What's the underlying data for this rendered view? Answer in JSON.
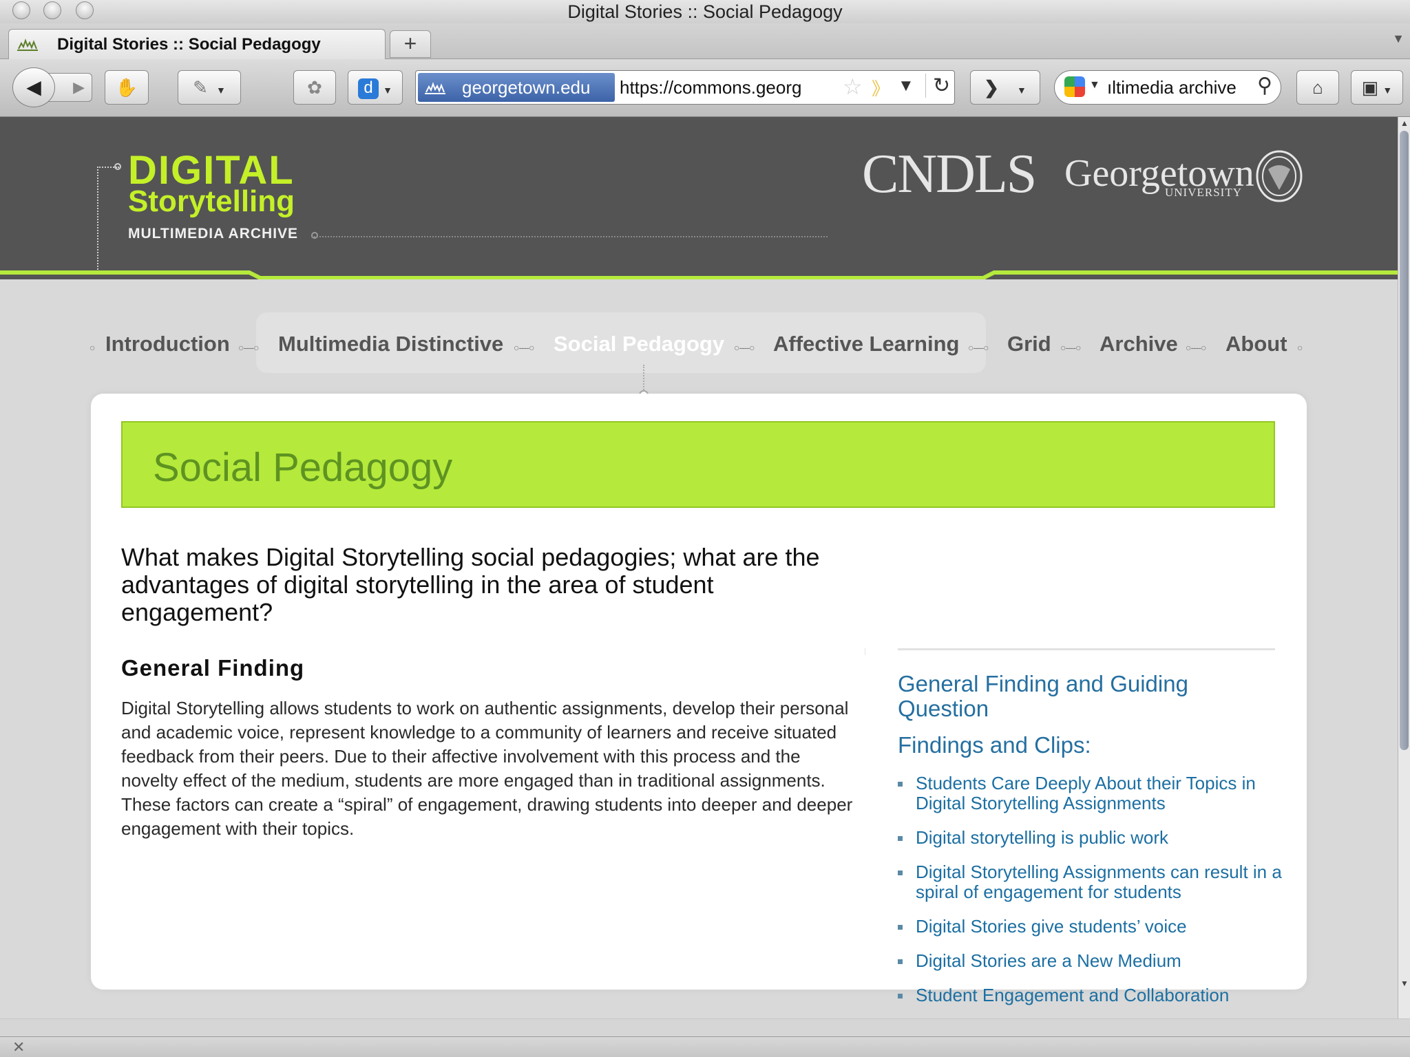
{
  "window": {
    "title": "Digital Stories :: Social Pedagogy"
  },
  "tabs": [
    {
      "label": "Digital Stories :: Social Pedagogy"
    }
  ],
  "toolbar": {
    "new_tab": "+",
    "back": "◀",
    "forward": "▶"
  },
  "url_bar": {
    "site_identity": "georgetown.edu",
    "url": "https://commons.georg"
  },
  "search_bar": {
    "value": "ıltimedia archive"
  },
  "site": {
    "logo": {
      "line1": "DIGITAL",
      "line2": "Storytelling",
      "line3": "MULTIMEDIA ARCHIVE"
    },
    "partner_logo": "CNDLS",
    "university": {
      "name": "Georgetown",
      "sub": "UNIVERSITY"
    },
    "nav": [
      {
        "label": "Introduction"
      },
      {
        "label": "Multimedia Distinctive"
      },
      {
        "label": "Social Pedagogy",
        "active": true
      },
      {
        "label": "Affective Learning"
      },
      {
        "label": "Grid"
      },
      {
        "label": "Archive"
      },
      {
        "label": "About"
      }
    ]
  },
  "content": {
    "page_title": "Social Pedagogy",
    "question": "What makes Digital Storytelling social pedagogies; what are the advantages of digital storytelling in the area of student engagement?",
    "finding_heading": "General Finding",
    "finding_body": "Digital Storytelling allows students to work on authentic assignments, develop their personal and academic voice, represent knowledge to a community of learners and receive situated feedback from their peers. Due to their affective involvement with this process and the novelty effect of the medium, students are more engaged than in traditional assignments. These factors can create a “spiral” of engagement, drawing students into deeper and deeper engagement with their topics."
  },
  "sidebar": {
    "heading1": "General Finding and Guiding Question",
    "heading2": "Findings and Clips:",
    "clips": [
      {
        "label": "Students Care Deeply About their Topics in Digital Storytelling Assignments"
      },
      {
        "label": "Digital storytelling is public work"
      },
      {
        "label": "Digital Storytelling Assignments can result in a spiral of engagement for students"
      },
      {
        "label": "Digital Stories give students’ voice"
      },
      {
        "label": "Digital Stories are a New Medium"
      },
      {
        "label": "Student Engagement and Collaboration"
      }
    ]
  },
  "colors": {
    "accent_lime": "#b5ea3c",
    "logo_lime": "#c4f028",
    "header_gray": "#545454",
    "link_blue": "#1c6fa2"
  }
}
